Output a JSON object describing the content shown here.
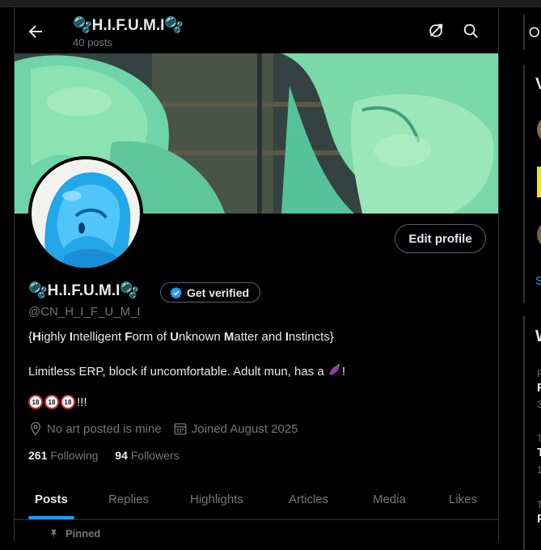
{
  "header": {
    "title": "🫧H.I.F.U.M.I🫧",
    "posts_count": "40 posts"
  },
  "profile": {
    "display_name": "🫧H.I.F.U.M.I🫧",
    "verify_label": "Get verified",
    "handle": "@CN_H_I_F_U_M_I",
    "edit_label": "Edit profile",
    "bio_line1_parts": [
      "{",
      "H",
      "ighly ",
      "I",
      "ntelligent ",
      "F",
      "orm of ",
      "U",
      "nknown ",
      "M",
      "atter and ",
      "I",
      "nstincts}"
    ],
    "bio_line2": "Limitless ERP, block if uncomfortable. Adult mun, has a",
    "bio_line2_end": "!",
    "bio_line3_badge": "18",
    "bio_line3_end": "!!!",
    "location": "No art posted is mine",
    "joined": "Joined August 2025",
    "following_count": "261",
    "following_label": "Following",
    "followers_count": "94",
    "followers_label": "Followers"
  },
  "tabs": [
    "Posts",
    "Replies",
    "Highlights",
    "Articles",
    "Media",
    "Likes"
  ],
  "active_tab": "Posts",
  "pinned_label": "Pinned",
  "sidebar": {
    "box1_letter": "V",
    "box1_link": "S",
    "box2_letter": "W",
    "box2_items": [
      "P",
      "F",
      "3",
      "T",
      "T",
      "1",
      "T",
      "P"
    ]
  },
  "colors": {
    "accent": "#1d9bf0",
    "bg": "#000000",
    "muted": "#71767b"
  }
}
